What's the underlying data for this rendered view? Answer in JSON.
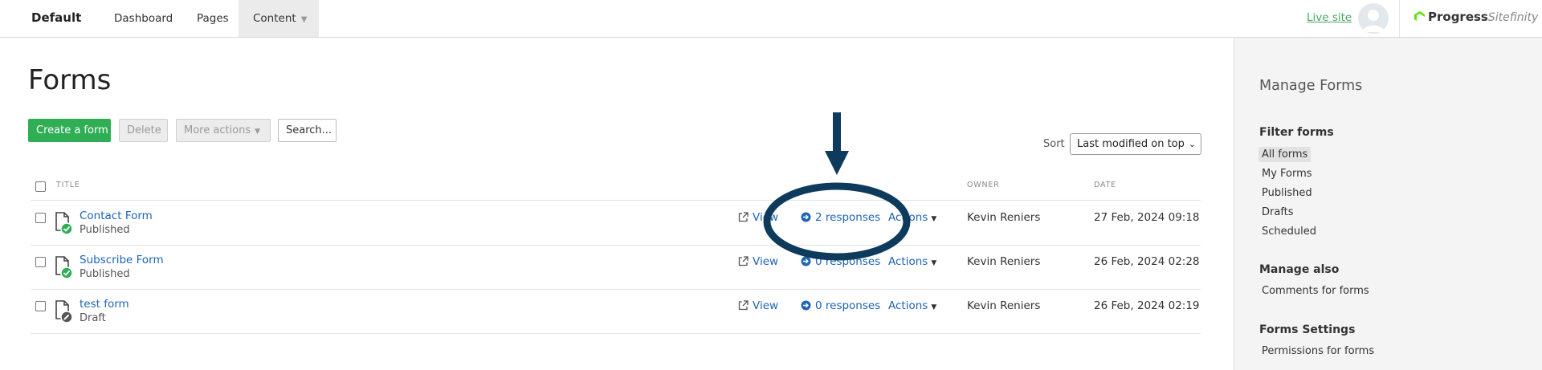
{
  "topbar": {
    "site_name": "Default",
    "nav": [
      "Dashboard",
      "Pages",
      "Content"
    ],
    "live_site": "Live site",
    "brand_name": "Progress",
    "brand_product": "Sitefinity"
  },
  "main": {
    "title": "Forms",
    "toolbar": {
      "create": "Create a form",
      "delete": "Delete",
      "more_actions": "More actions",
      "search": "Search..."
    },
    "sort": {
      "label": "Sort",
      "selected": "Last modified on top"
    },
    "columns": {
      "title": "TITLE",
      "owner": "OWNER",
      "date": "DATE"
    },
    "rows": [
      {
        "title": "Contact Form",
        "status": "Published",
        "view": "View",
        "responses": "2 responses",
        "actions": "Actions",
        "owner": "Kevin Reniers",
        "date": "27 Feb, 2024 09:18"
      },
      {
        "title": "Subscribe Form",
        "status": "Published",
        "view": "View",
        "responses": "0 responses",
        "actions": "Actions",
        "owner": "Kevin Reniers",
        "date": "26 Feb, 2024 02:28"
      },
      {
        "title": "test form",
        "status": "Draft",
        "view": "View",
        "responses": "0 responses",
        "actions": "Actions",
        "owner": "Kevin Reniers",
        "date": "26 Feb, 2024 02:19"
      }
    ]
  },
  "sidebar": {
    "title": "Manage Forms",
    "filter_heading": "Filter forms",
    "filters": [
      "All forms",
      "My Forms",
      "Published",
      "Drafts",
      "Scheduled"
    ],
    "manage_heading": "Manage also",
    "manage_items": [
      "Comments for forms"
    ],
    "settings_heading": "Forms Settings",
    "settings_items": [
      "Permissions for forms"
    ]
  },
  "colors": {
    "primary_button": "#2fae56",
    "link": "#1e63b8",
    "live_site": "#4aa564",
    "annotation": "#0e3a5c",
    "status_published": "#2fae56",
    "status_draft": "#555555"
  }
}
